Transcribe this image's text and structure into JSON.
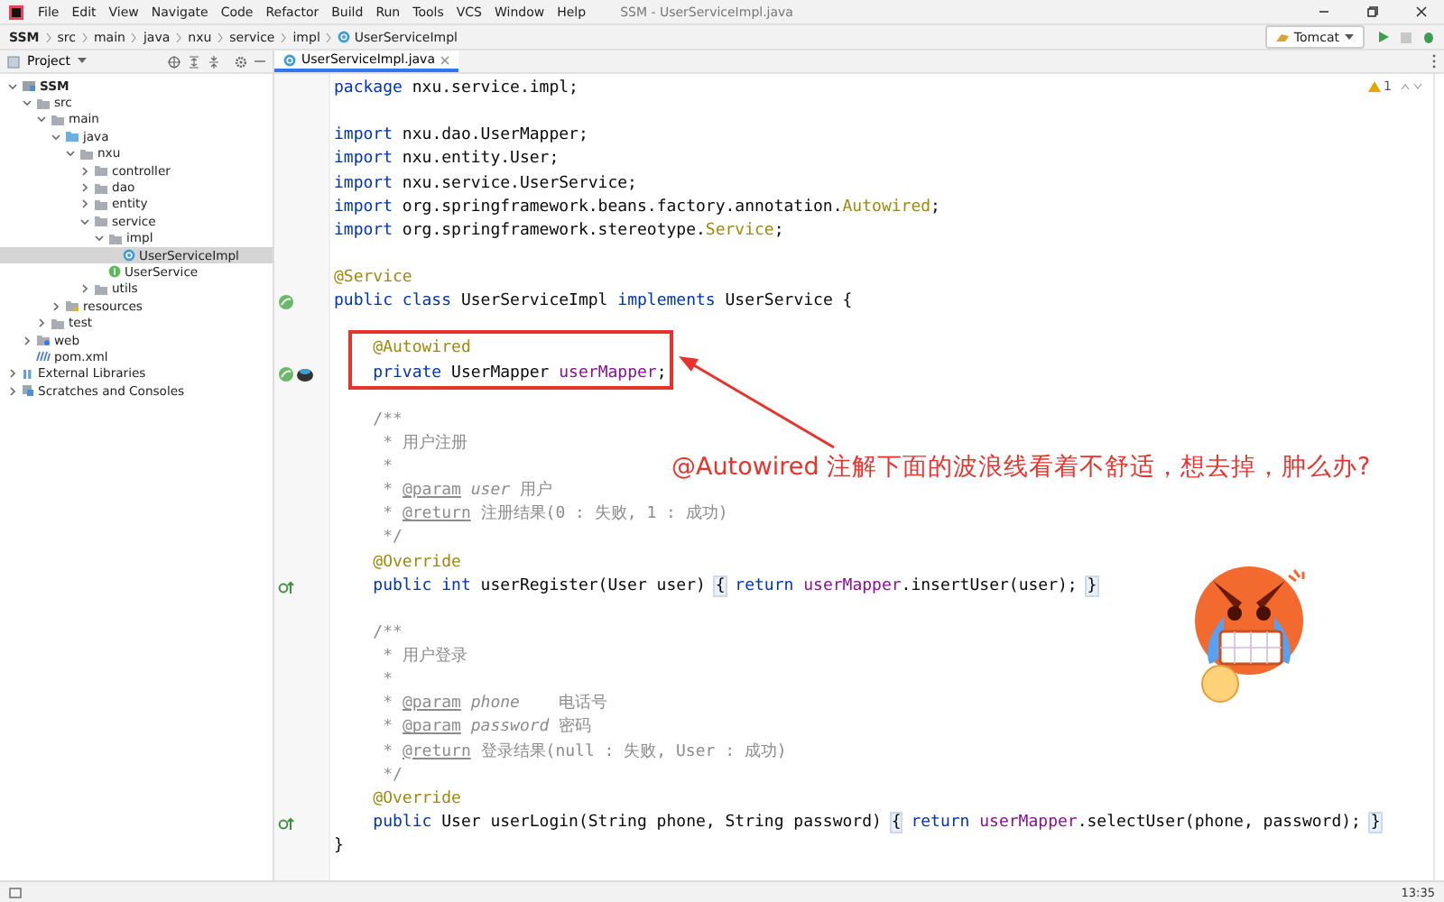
{
  "menu_bar": {
    "items": [
      "File",
      "Edit",
      "View",
      "Navigate",
      "Code",
      "Refactor",
      "Build",
      "Run",
      "Tools",
      "VCS",
      "Window",
      "Help"
    ],
    "title": "SSM - UserServiceImpl.java"
  },
  "breadcrumbs": [
    {
      "label": "SSM",
      "kind": "project"
    },
    {
      "label": "src",
      "kind": "folder"
    },
    {
      "label": "main",
      "kind": "folder"
    },
    {
      "label": "java",
      "kind": "folder"
    },
    {
      "label": "nxu",
      "kind": "folder"
    },
    {
      "label": "service",
      "kind": "folder"
    },
    {
      "label": "impl",
      "kind": "folder"
    },
    {
      "label": "UserServiceImpl",
      "kind": "class"
    }
  ],
  "run_config": {
    "label": "Tomcat"
  },
  "project_panel": {
    "title": "Project"
  },
  "project_tree": [
    {
      "label": "SSM",
      "kind": "module",
      "expanded": true,
      "selected": false,
      "children": [
        {
          "label": "src",
          "kind": "folder",
          "expanded": true,
          "selected": false,
          "children": [
            {
              "label": "main",
              "kind": "folder",
              "expanded": true,
              "selected": false,
              "children": [
                {
                  "label": "java",
                  "kind": "source",
                  "expanded": true,
                  "selected": false,
                  "children": [
                    {
                      "label": "nxu",
                      "kind": "folder",
                      "expanded": true,
                      "selected": false,
                      "children": [
                        {
                          "label": "controller",
                          "kind": "folder",
                          "expanded": false,
                          "selected": false
                        },
                        {
                          "label": "dao",
                          "kind": "folder",
                          "expanded": false,
                          "selected": false
                        },
                        {
                          "label": "entity",
                          "kind": "folder",
                          "expanded": false,
                          "selected": false
                        },
                        {
                          "label": "service",
                          "kind": "folder",
                          "expanded": true,
                          "selected": false,
                          "children": [
                            {
                              "label": "impl",
                              "kind": "folder",
                              "expanded": true,
                              "selected": false,
                              "children": [
                                {
                                  "label": "UserServiceImpl",
                                  "kind": "class",
                                  "selected": true
                                }
                              ]
                            },
                            {
                              "label": "UserService",
                              "kind": "interface",
                              "selected": false
                            }
                          ]
                        },
                        {
                          "label": "utils",
                          "kind": "folder",
                          "expanded": false,
                          "selected": false
                        }
                      ]
                    }
                  ]
                },
                {
                  "label": "resources",
                  "kind": "resources",
                  "expanded": false,
                  "selected": false
                }
              ]
            },
            {
              "label": "test",
              "kind": "folder",
              "expanded": false,
              "selected": false
            }
          ]
        },
        {
          "label": "web",
          "kind": "web",
          "expanded": false,
          "selected": false
        },
        {
          "label": "pom.xml",
          "kind": "maven",
          "selected": false
        }
      ]
    },
    {
      "label": "External Libraries",
      "kind": "libraries",
      "expanded": false,
      "selected": false
    },
    {
      "label": "Scratches and Consoles",
      "kind": "scratches",
      "expanded": false,
      "selected": false
    }
  ],
  "editor_tab": {
    "label": "UserServiceImpl.java",
    "selected": true
  },
  "warnings": {
    "count": "1"
  },
  "code_lines": [
    {
      "segments": [
        {
          "kind": "keyword",
          "text": "package"
        },
        {
          "kind": "plain",
          "text": " nxu.service.impl;"
        }
      ]
    },
    {
      "gap_before": true,
      "segments": [
        {
          "kind": "keyword",
          "text": "import"
        },
        {
          "kind": "plain",
          "text": " nxu.dao.UserMapper;"
        }
      ]
    },
    {
      "segments": [
        {
          "kind": "keyword",
          "text": "import"
        },
        {
          "kind": "plain",
          "text": " nxu.entity.User;"
        }
      ]
    },
    {
      "segments": [
        {
          "kind": "keyword",
          "text": "import"
        },
        {
          "kind": "plain",
          "text": " nxu.service.UserService;"
        }
      ]
    },
    {
      "segments": [
        {
          "kind": "keyword",
          "text": "import"
        },
        {
          "kind": "plain",
          "text": " org.springframework.beans.factory.annotation."
        },
        {
          "kind": "annotation",
          "text": "Autowired"
        },
        {
          "kind": "plain",
          "text": ";"
        }
      ]
    },
    {
      "segments": [
        {
          "kind": "keyword",
          "text": "import"
        },
        {
          "kind": "plain",
          "text": " org.springframework.stereotype."
        },
        {
          "kind": "annotation",
          "text": "Service"
        },
        {
          "kind": "plain",
          "text": ";"
        }
      ]
    },
    {
      "gap_before": true,
      "segments": [
        {
          "kind": "annotation",
          "text": "@Service"
        }
      ]
    },
    {
      "gutter": {
        "kind": "bean"
      },
      "segments": [
        {
          "kind": "keyword",
          "text": "public class"
        },
        {
          "kind": "plain",
          "text": " UserServiceImpl "
        },
        {
          "kind": "keyword",
          "text": "implements"
        },
        {
          "kind": "plain",
          "text": " UserService {"
        }
      ]
    },
    {
      "gap_before": true,
      "segments": [
        {
          "kind": "annotation",
          "text": "    @Autowired"
        }
      ]
    },
    {
      "gutter": {
        "kind": "bean-db"
      },
      "segments": [
        {
          "kind": "keyword",
          "text": "    private"
        },
        {
          "kind": "plain",
          "text": " UserMapper "
        },
        {
          "kind": "field",
          "text": "userMapper"
        },
        {
          "kind": "plain",
          "text": ";"
        }
      ]
    },
    {
      "gap_before": true,
      "segments": [
        {
          "kind": "comment",
          "text": "    /**"
        }
      ]
    },
    {
      "segments": [
        {
          "kind": "comment",
          "text": "     * 用户注册"
        }
      ]
    },
    {
      "segments": [
        {
          "kind": "comment",
          "text": "     *"
        }
      ]
    },
    {
      "segments": [
        {
          "kind": "comment",
          "text": "     * "
        },
        {
          "kind": "doctag",
          "text": "@param"
        },
        {
          "kind": "docparam",
          "text": " user"
        },
        {
          "kind": "comment",
          "text": " 用户"
        }
      ]
    },
    {
      "segments": [
        {
          "kind": "comment",
          "text": "     * "
        },
        {
          "kind": "doctag",
          "text": "@return"
        },
        {
          "kind": "comment",
          "text": " 注册结果(0 : 失败, 1 : 成功)"
        }
      ]
    },
    {
      "segments": [
        {
          "kind": "comment",
          "text": "     */"
        }
      ]
    },
    {
      "segments": [
        {
          "kind": "annotation",
          "text": "    @Override"
        }
      ]
    },
    {
      "gutter": {
        "kind": "override"
      },
      "segments": [
        {
          "kind": "keyword",
          "text": "    public int"
        },
        {
          "kind": "plain",
          "text": " userRegister(User user) "
        },
        {
          "kind": "fold",
          "text": "{"
        },
        {
          "kind": "keyword",
          "text": " return"
        },
        {
          "kind": "field",
          "text": " userMapper"
        },
        {
          "kind": "plain",
          "text": ".insertUser(user); "
        },
        {
          "kind": "fold",
          "text": "}"
        }
      ]
    },
    {
      "gap_before": true,
      "segments": [
        {
          "kind": "comment",
          "text": "    /**"
        }
      ]
    },
    {
      "segments": [
        {
          "kind": "comment",
          "text": "     * 用户登录"
        }
      ]
    },
    {
      "segments": [
        {
          "kind": "comment",
          "text": "     *"
        }
      ]
    },
    {
      "segments": [
        {
          "kind": "comment",
          "text": "     * "
        },
        {
          "kind": "doctag",
          "text": "@param"
        },
        {
          "kind": "docparam",
          "text": " phone"
        },
        {
          "kind": "comment",
          "text": "    电话号"
        }
      ]
    },
    {
      "segments": [
        {
          "kind": "comment",
          "text": "     * "
        },
        {
          "kind": "doctag",
          "text": "@param"
        },
        {
          "kind": "docparam",
          "text": " password"
        },
        {
          "kind": "comment",
          "text": " 密码"
        }
      ]
    },
    {
      "segments": [
        {
          "kind": "comment",
          "text": "     * "
        },
        {
          "kind": "doctag",
          "text": "@return"
        },
        {
          "kind": "comment",
          "text": " 登录结果(null : 失败, User : 成功)"
        }
      ]
    },
    {
      "segments": [
        {
          "kind": "comment",
          "text": "     */"
        }
      ]
    },
    {
      "segments": [
        {
          "kind": "annotation",
          "text": "    @Override"
        }
      ]
    },
    {
      "gutter": {
        "kind": "override"
      },
      "segments": [
        {
          "kind": "keyword",
          "text": "    public"
        },
        {
          "kind": "plain",
          "text": " User userLogin(String phone, String password) "
        },
        {
          "kind": "fold",
          "text": "{"
        },
        {
          "kind": "keyword",
          "text": " return"
        },
        {
          "kind": "field",
          "text": " userMapper"
        },
        {
          "kind": "plain",
          "text": ".selectUser(phone, password); "
        },
        {
          "kind": "fold",
          "text": "}"
        }
      ]
    },
    {
      "segments": [
        {
          "kind": "plain",
          "text": "}"
        }
      ]
    }
  ],
  "annotation": {
    "text": "@Autowired 注解下面的波浪线看着不舒适，想去掉，肿么办?"
  },
  "status_bar": {
    "time": "13:35"
  }
}
